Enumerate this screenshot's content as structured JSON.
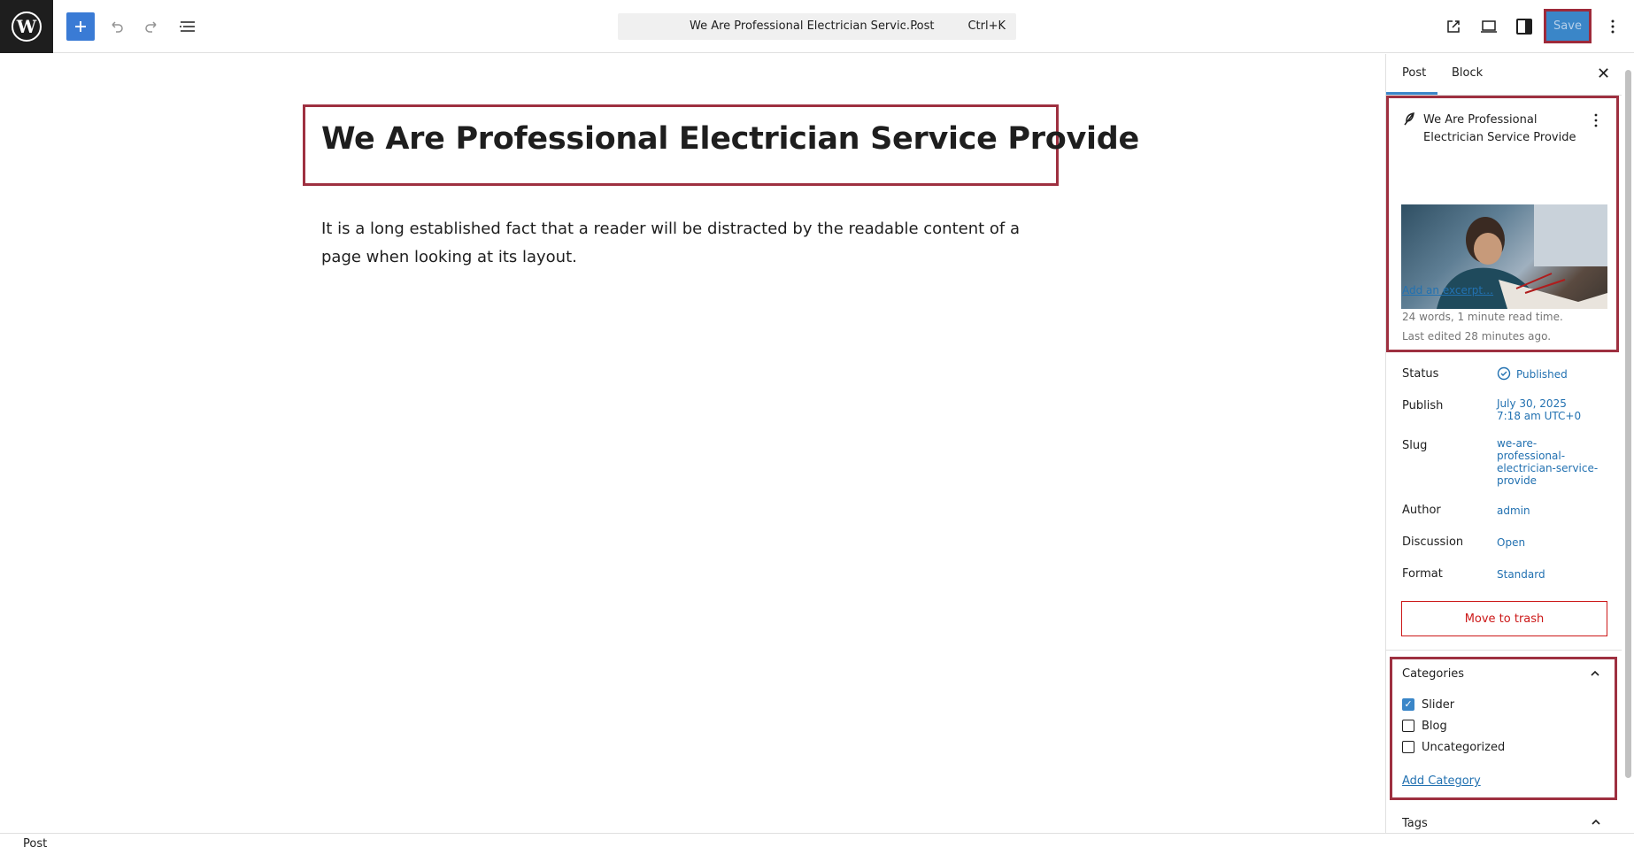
{
  "topbar": {
    "command_title": "We Are Professional Electrician Servic…",
    "command_type": "· Post",
    "command_shortcut": "Ctrl+K",
    "save_label": "Save"
  },
  "editor": {
    "title": "We Are Professional Electrician Service Provide",
    "body": "It is a long established fact that a reader will be distracted by the readable content of a page when looking at its layout."
  },
  "sidebar": {
    "tabs": [
      "Post",
      "Block"
    ],
    "post_title": "We Are Professional Electrician Service Provide",
    "add_excerpt": "Add an excerpt…",
    "stats_words": "24 words, 1 minute read time.",
    "stats_edited": "Last edited 28 minutes ago.",
    "fields": {
      "status_label": "Status",
      "status_value": "Published",
      "publish_label": "Publish",
      "publish_date": "July 30, 2025",
      "publish_time": "7:18 am UTC+0",
      "slug_label": "Slug",
      "slug_lines": [
        "we-are-",
        "professional-",
        "electrician-service-",
        "provide"
      ],
      "author_label": "Author",
      "author_value": "admin",
      "discussion_label": "Discussion",
      "discussion_value": "Open",
      "format_label": "Format",
      "format_value": "Standard"
    },
    "trash_label": "Move to trash",
    "categories": {
      "title": "Categories",
      "items": [
        {
          "label": "Slider",
          "checked": true
        },
        {
          "label": "Blog",
          "checked": false
        },
        {
          "label": "Uncategorized",
          "checked": false
        }
      ],
      "add_label": "Add Category"
    },
    "tags_title": "Tags"
  },
  "footer": {
    "breadcrumb": "Post"
  },
  "colors": {
    "accent": "#3a86c8",
    "highlight_border": "#9e3040",
    "danger": "#cc1818",
    "link": "#2271b1"
  }
}
